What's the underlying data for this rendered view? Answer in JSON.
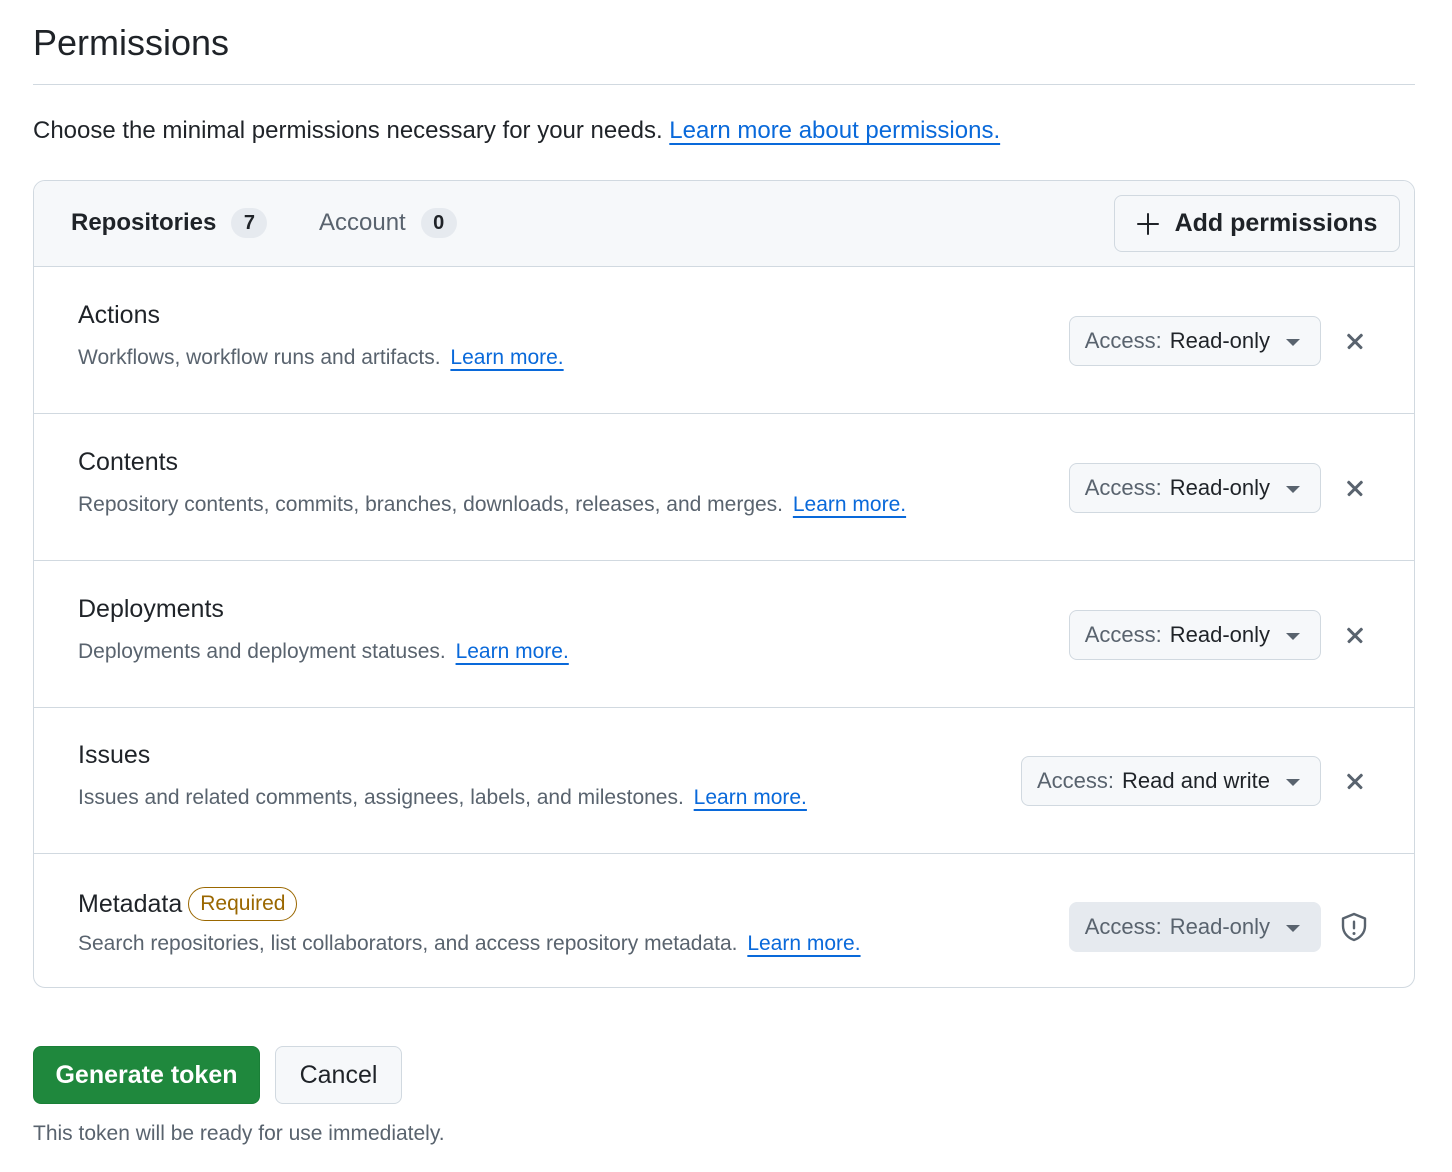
{
  "header": {
    "title": "Permissions",
    "intro_text": "Choose the minimal permissions necessary for your needs.",
    "intro_link": "Learn more about permissions."
  },
  "tabs": [
    {
      "label": "Repositories",
      "count": "7",
      "selected": true
    },
    {
      "label": "Account",
      "count": "0",
      "selected": false
    }
  ],
  "add_permissions_label": "Add permissions",
  "access_label": "Access:",
  "permissions": [
    {
      "name": "Actions",
      "description": "Workflows, workflow runs and artifacts.",
      "link": "Learn more.",
      "access": "Read-only",
      "removable": true
    },
    {
      "name": "Contents",
      "description": "Repository contents, commits, branches, downloads, releases, and merges.",
      "link": "Learn more.",
      "access": "Read-only",
      "removable": true
    },
    {
      "name": "Deployments",
      "description": "Deployments and deployment statuses.",
      "link": "Learn more.",
      "access": "Read-only",
      "removable": true
    },
    {
      "name": "Issues",
      "description": "Issues and related comments, assignees, labels, and milestones.",
      "link": "Learn more.",
      "access": "Read and write",
      "removable": true
    },
    {
      "name": "Metadata",
      "badge": "Required",
      "description": "Search repositories, list collaborators, and access repository metadata.",
      "link": "Learn more.",
      "access": "Read-only",
      "removable": false
    }
  ],
  "actions": {
    "generate_label": "Generate token",
    "cancel_label": "Cancel",
    "footnote": "This token will be ready for use immediately."
  },
  "colors": {
    "primary_button": "#1f883d",
    "link": "#0969da",
    "required_badge": "#9a6700",
    "border": "#d1d9e0"
  },
  "icons": {
    "add": "plus-icon",
    "remove": "x-icon",
    "dropdown": "triangle-down-icon",
    "required": "shield-icon"
  }
}
